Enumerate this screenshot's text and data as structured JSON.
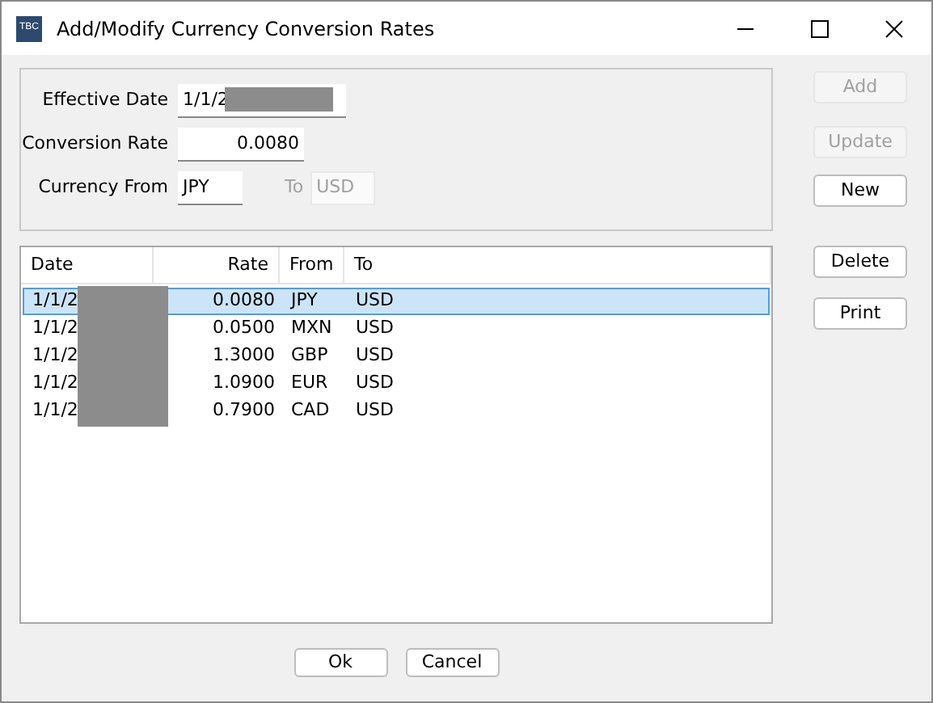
{
  "window": {
    "title": "Add/Modify Currency Conversion Rates",
    "app_icon": "TBC"
  },
  "form": {
    "effective_date": {
      "label": "Effective Date",
      "value": "1/1/2",
      "redacted": true
    },
    "conversion_rate": {
      "label": "Conversion Rate",
      "value": "0.0080"
    },
    "currency_from": {
      "label": "Currency From",
      "value": "JPY"
    },
    "currency_to": {
      "label": "To",
      "value": "USD",
      "disabled": true
    }
  },
  "side_buttons": [
    {
      "label": "Add",
      "disabled": true
    },
    {
      "label": "Update",
      "disabled": true
    },
    {
      "label": "New",
      "disabled": false
    },
    {
      "label": "Delete",
      "disabled": false
    },
    {
      "label": "Print",
      "disabled": false
    }
  ],
  "table": {
    "columns": [
      "Date",
      "Rate",
      "From",
      "To"
    ],
    "rows": [
      {
        "cells": [
          "1/1/2",
          "0.0080",
          "JPY",
          "USD"
        ],
        "selected": true,
        "redacted": true
      },
      {
        "cells": [
          "1/1/2",
          "0.0500",
          "MXN",
          "USD"
        ],
        "selected": false,
        "redacted": true
      },
      {
        "cells": [
          "1/1/2",
          "1.3000",
          "GBP",
          "USD"
        ],
        "selected": false,
        "redacted": true
      },
      {
        "cells": [
          "1/1/2",
          "1.0900",
          "EUR",
          "USD"
        ],
        "selected": false,
        "redacted": true
      },
      {
        "cells": [
          "1/1/2",
          "0.7900",
          "CAD",
          "USD"
        ],
        "selected": false,
        "redacted": true
      }
    ]
  },
  "footer_buttons": [
    "Ok",
    "Cancel"
  ]
}
